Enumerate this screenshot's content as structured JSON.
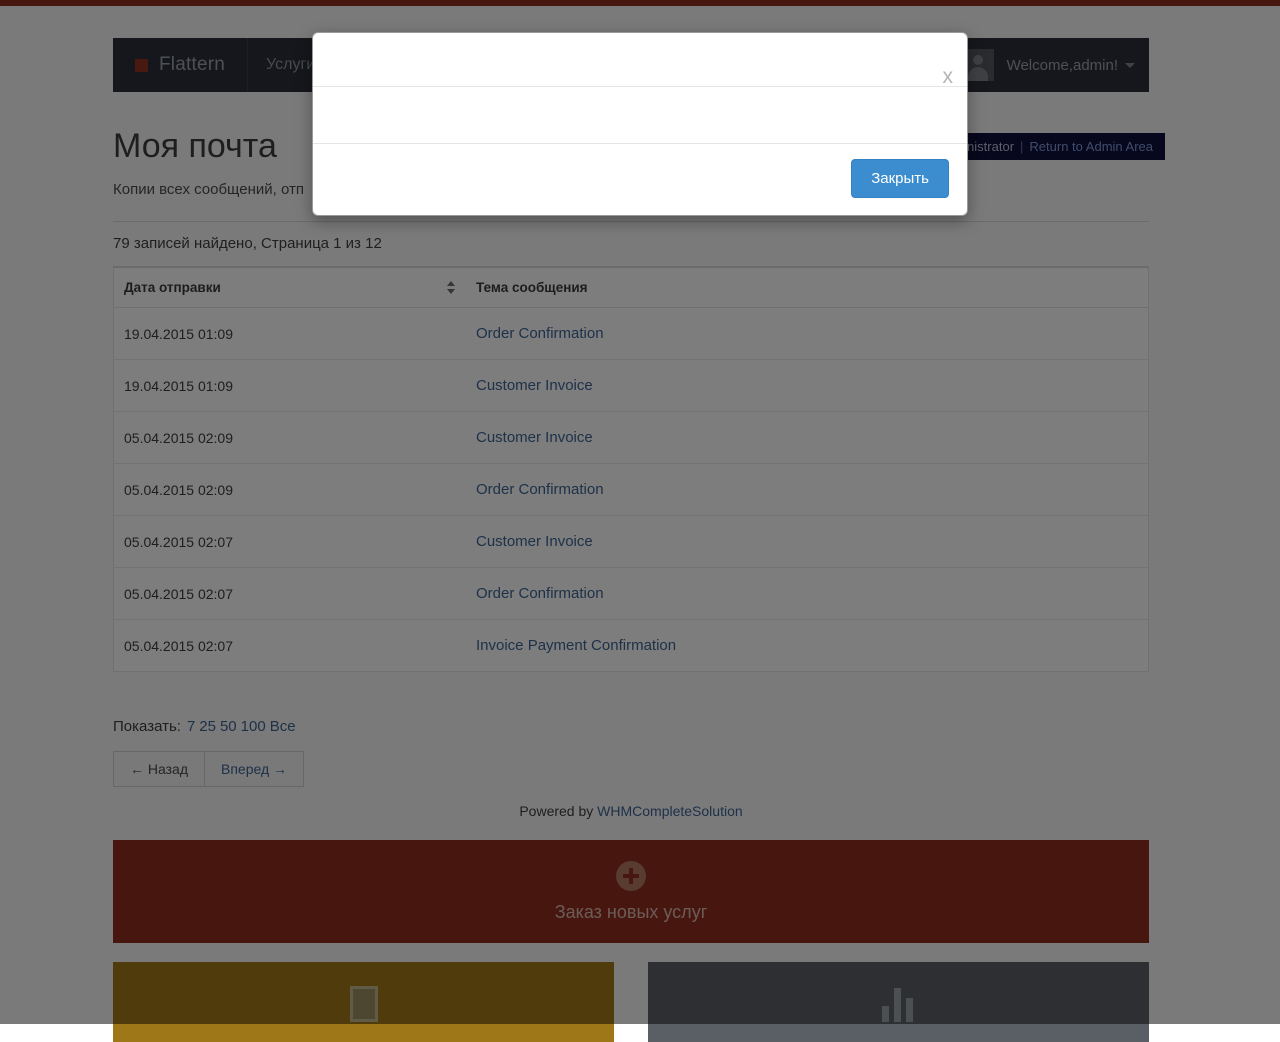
{
  "navbar": {
    "brand": "Flattern",
    "items": [
      {
        "label": "Услуги",
        "has_caret": true
      }
    ],
    "user": {
      "welcome": "Welcome,admin!",
      "avatar_icon": "user-avatar-icon",
      "caret_icon": "chevron-down-icon"
    }
  },
  "admin_bar": {
    "prefix": "dministrator",
    "separator": "|",
    "return_link": "Return to Admin Area"
  },
  "page": {
    "title": "Моя почта",
    "subtitle": "Копии всех сообщений, отп",
    "summary": "79 записей найдено, Страница 1 из 12"
  },
  "table": {
    "columns": [
      "Дата отправки",
      "Тема сообщения"
    ],
    "sort_icon": "sort-updown-icon",
    "rows": [
      {
        "date": "19.04.2015 01:09",
        "subject": "Order Confirmation"
      },
      {
        "date": "19.04.2015 01:09",
        "subject": "Customer Invoice"
      },
      {
        "date": "05.04.2015 02:09",
        "subject": "Customer Invoice"
      },
      {
        "date": "05.04.2015 02:09",
        "subject": "Order Confirmation"
      },
      {
        "date": "05.04.2015 02:07",
        "subject": "Customer Invoice"
      },
      {
        "date": "05.04.2015 02:07",
        "subject": "Order Confirmation"
      },
      {
        "date": "05.04.2015 02:07",
        "subject": "Invoice Payment Confirmation"
      }
    ]
  },
  "show": {
    "label": "Показать:",
    "options": [
      "7",
      "25",
      "50",
      "100",
      "Все"
    ]
  },
  "pager": {
    "prev": "← Назад",
    "next": "Вперед →"
  },
  "footer": {
    "powered_prefix": "Powered by",
    "powered_link": "WHMCompleteSolution"
  },
  "promos": {
    "order": {
      "label": "Заказ новых услуг",
      "icon": "plus-circle-icon"
    },
    "cards": [
      {
        "icon": "document-icon",
        "color": "#9e7718"
      },
      {
        "icon": "bar-chart-icon",
        "color": "#5a5f66"
      }
    ]
  },
  "modal": {
    "title": "",
    "close_icon": "x",
    "body": "",
    "button": "Закрыть"
  },
  "colors": {
    "top_stripe": "#8f2c1c",
    "navbar": "#2b2e39",
    "brand_mark": "#8f3322",
    "admin_bar": "#0e0f3a",
    "link": "#3c6292",
    "promo_order": "#8f2f1f",
    "promo_gold": "#9e7718",
    "promo_slate": "#5a5f66",
    "modal_button": "#3c8dd0",
    "backdrop": "rgba(0,0,0,0.5)"
  }
}
